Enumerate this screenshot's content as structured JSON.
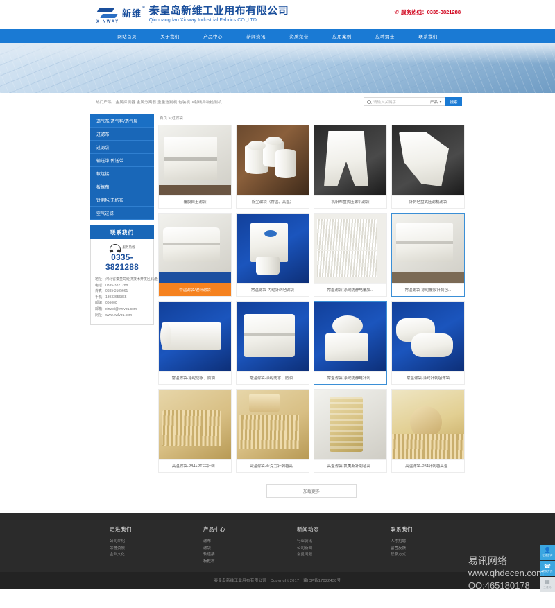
{
  "header": {
    "logo_badge": "新维",
    "logo_latin": "XINWAY",
    "company_cn": "秦皇岛新维工业用布有限公司",
    "company_en": "Qinhuangdao Xinway Industrial Fabrics CO.,LTD",
    "hotline": "服务热线：0335-3821288"
  },
  "nav": [
    {
      "label": "网站首页"
    },
    {
      "label": "关于我们"
    },
    {
      "label": "产品中心"
    },
    {
      "label": "新闻资讯"
    },
    {
      "label": "资质荣誉"
    },
    {
      "label": "应用案例"
    },
    {
      "label": "应聘纳士"
    },
    {
      "label": "联系我们"
    }
  ],
  "search": {
    "hotwords": "热门产品：金属探测器 金属分离器 重量选别机 包装机 X射线异物检测机",
    "placeholder": "请输入关键字",
    "category": "产品",
    "button": "搜索"
  },
  "sidebar": {
    "items": [
      {
        "label": "透气布/透气毡/透气层"
      },
      {
        "label": "过滤布"
      },
      {
        "label": "过滤袋"
      },
      {
        "label": "输送带/传送带"
      },
      {
        "label": "软连接"
      },
      {
        "label": "板框布"
      },
      {
        "label": "针刺毡/无纺布"
      },
      {
        "label": "空气过滤"
      }
    ],
    "contact_title": "联系我们",
    "phone_label": "服务热线",
    "phone": "0335-3821288",
    "lines": [
      "地址：河北省秦皇岛经济技术开发区北港大街99号",
      "电话：0335-3821288",
      "传真：0335-3105661",
      "手机：13933656865",
      "邮编：066000",
      "邮箱：xinwei@xwlvbu.com",
      "网址：www.xwlvbu.com"
    ]
  },
  "main": {
    "breadcrumb": "首页 > 过滤袋",
    "load_more": "加载更多",
    "products": [
      {
        "title": "覆膜白土滤袋",
        "thumb": "white-fabric-fold"
      },
      {
        "title": "除尘滤袋（常温、高温）",
        "thumb": "tubes-on-brown"
      },
      {
        "title": "机织布盘式压滤机滤袋",
        "thumb": "white-bag-dark"
      },
      {
        "title": "针刺毡盘式压滤机滤袋",
        "thumb": "white-bag-dark2"
      },
      {
        "title": "中温滤袋/玻纤滤袋",
        "thumb": "white-bag-blue",
        "active": true
      },
      {
        "title": "常温滤袋-丙纶针刺毡滤袋",
        "thumb": "blue-bag"
      },
      {
        "title": "常温滤袋-涤纶防静电覆膜...",
        "thumb": "pleated-white"
      },
      {
        "title": "常温滤袋-涤纶覆膜针刺毡...",
        "thumb": "white-fabric-fold2",
        "highlight": true
      },
      {
        "title": "常温滤袋-涤纶防水、防油...",
        "thumb": "blue-roll"
      },
      {
        "title": "常温滤袋-涤纶防水、防油...",
        "thumb": "white-bag-blue2"
      },
      {
        "title": "常温滤袋-涤纶防静电针刺...",
        "thumb": "disc-blue",
        "highlight": true
      },
      {
        "title": "常温滤袋-涤纶针刺毡滤袋",
        "thumb": "bags-blue"
      },
      {
        "title": "高温滤袋-P84+PTFE针刺...",
        "thumb": "tan-folded"
      },
      {
        "title": "高温滤袋-亚克力针刺毡高...",
        "thumb": "tan-stack"
      },
      {
        "title": "高温滤袋-氟美斯针刺毡高...",
        "thumb": "yellow-bag"
      },
      {
        "title": "高温滤袋-P84针刺毡高温...",
        "thumb": "tan-round"
      }
    ]
  },
  "footer": {
    "columns": [
      {
        "title": "走进我们",
        "links": [
          "公司介绍",
          "荣誉资质",
          "企业文化"
        ]
      },
      {
        "title": "产品中心",
        "links": [
          "滤布",
          "滤袋",
          "软连接",
          "板框布"
        ]
      },
      {
        "title": "新闻动态",
        "links": [
          "行业资讯",
          "公司新闻",
          "常见问题"
        ]
      },
      {
        "title": "联系我们",
        "links": [
          "人才招聘",
          "留言反馈",
          "联系方式"
        ]
      }
    ],
    "copyright": "秦皇岛新维工业用布有限公司　Copyright 2017　冀ICP备17022438号"
  },
  "floating": [
    {
      "icon": "👤",
      "label": "在线咨询"
    },
    {
      "icon": "✆",
      "label": "联系方式"
    },
    {
      "icon": "▦",
      "label": "二维码"
    }
  ],
  "watermark": {
    "line1": "易讯网络",
    "line2": "www.qhdecen.com",
    "line3": "QQ:465180178"
  },
  "colors": {
    "brand_blue": "#1a7ad4",
    "deep_blue": "#1a4f9c",
    "accent_orange": "#f5821f",
    "hotline_red": "#d0021b"
  }
}
